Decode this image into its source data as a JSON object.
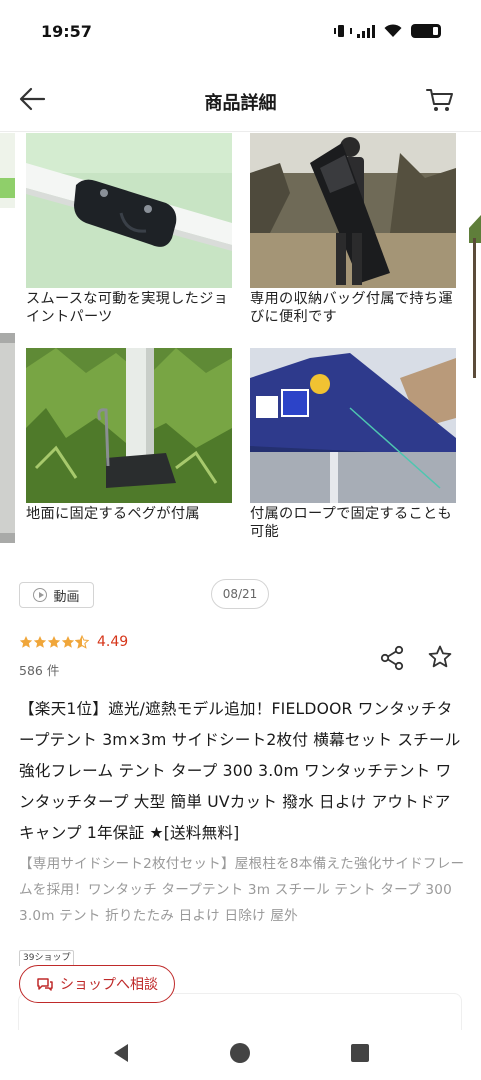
{
  "status_bar": {
    "time": "19:57"
  },
  "header": {
    "title": "商品詳細"
  },
  "gallery": {
    "items": [
      {
        "caption": "スムースな可動を実現したジョイントパーツ"
      },
      {
        "caption": "専用の収納バッグ付属で持ち運びに便利です"
      },
      {
        "caption": "地面に固定するペグが付属"
      },
      {
        "caption": "付属のロープで固定することも可能"
      }
    ],
    "video_label": "動画",
    "page_counter": "08/21"
  },
  "rating": {
    "value": "4.49",
    "stars": 4.49,
    "count": "586 件"
  },
  "product": {
    "title": "【楽天1位】遮光/遮熱モデル追加！FIELDOOR ワンタッチタープテント 3m×3m サイドシート2枚付 横幕セット スチール 強化フレーム テント タープ 300 3.0m ワンタッチテント ワンタッチタープ 大型 簡単 UVカット 撥水 日よけ アウトドア キャンプ 1年保証 ★[送料無料]",
    "description": "【専用サイドシート2枚付セット】屋根柱を8本備えた強化サイドフレームを採用！ワンタッチ タープテント 3m スチール テント タープ 300 3.0m テント 折りたたみ 日よけ 日除け 屋外"
  },
  "shop": {
    "tag": "39ショップ",
    "consult_label": "ショップへ相談"
  },
  "colors": {
    "accent": "#bf2a2a",
    "rating": "#d6361a",
    "star": "#f0a63a",
    "tent_blue": "#2e3a8c"
  }
}
